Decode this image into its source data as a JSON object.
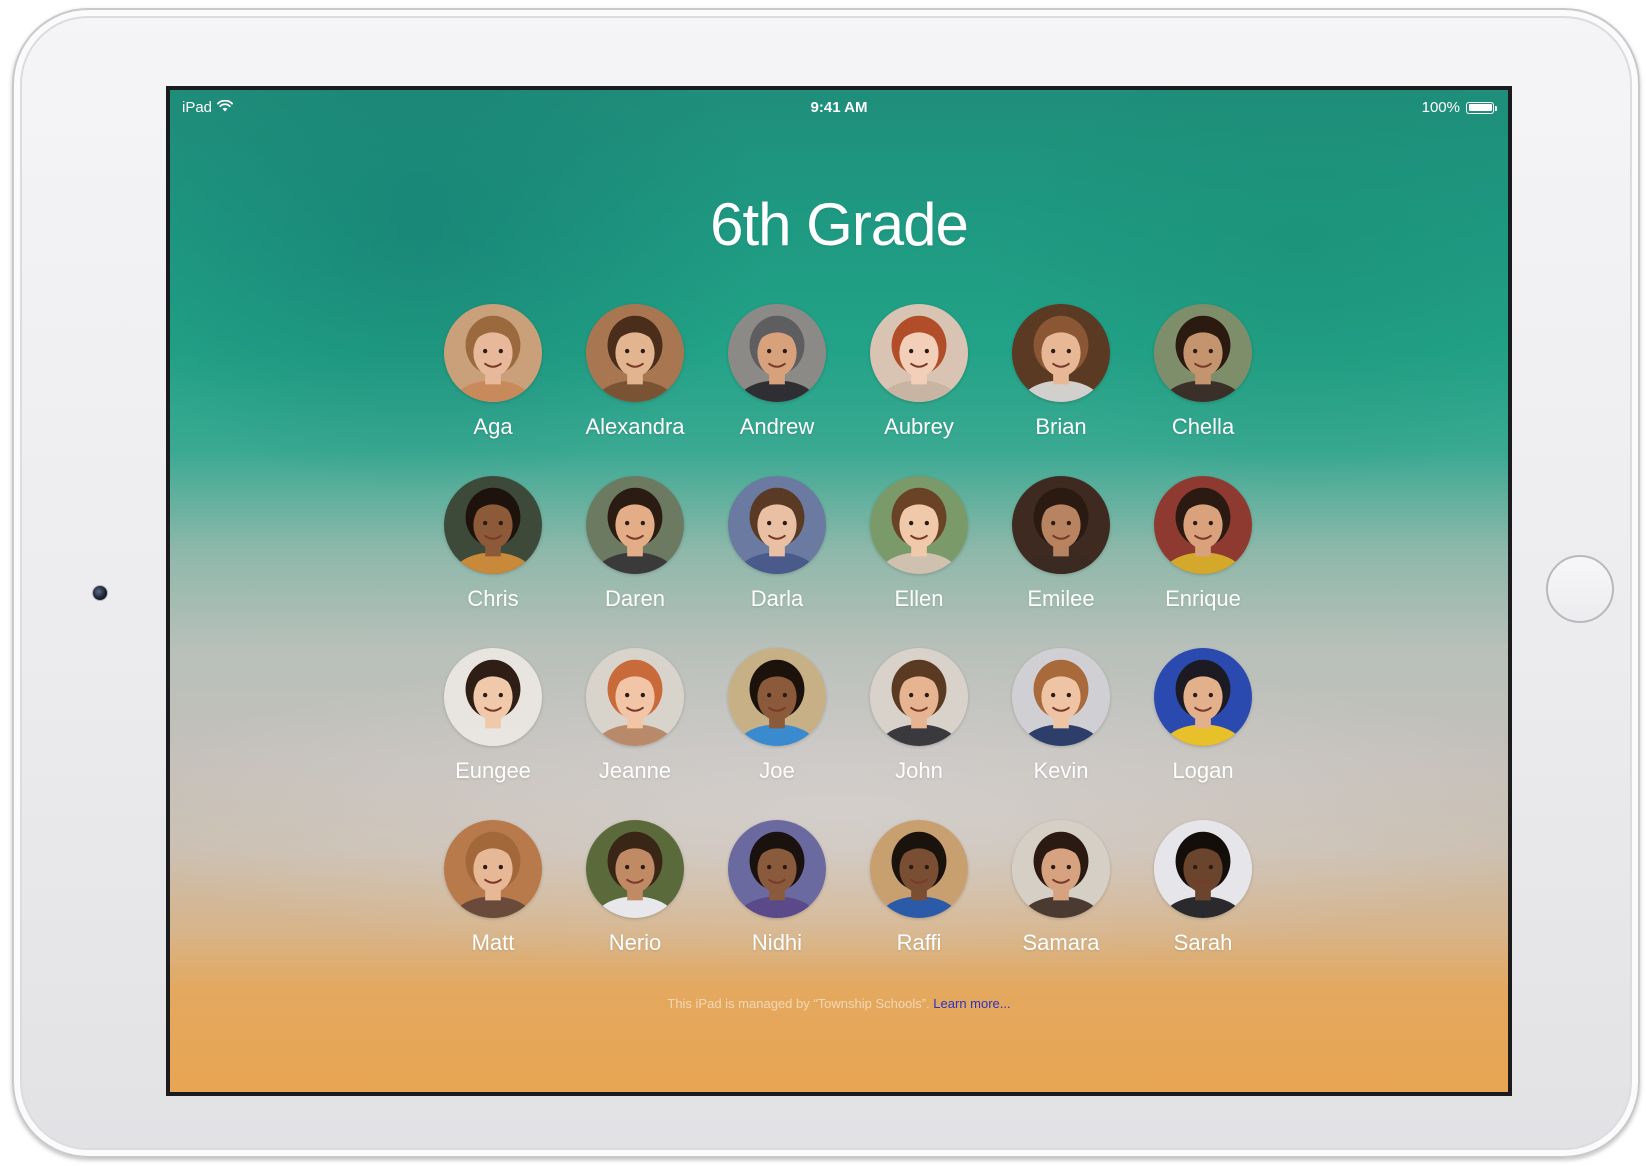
{
  "status_bar": {
    "device_label": "iPad",
    "time": "9:41 AM",
    "battery_percent": "100%",
    "battery_level": 1.0
  },
  "page": {
    "title": "6th Grade"
  },
  "students": [
    {
      "name": "Aga",
      "skin": "#e7b99a",
      "hair": "#9a6a3e",
      "bg": "#c9a07a",
      "shirt": "#c88a5a"
    },
    {
      "name": "Alexandra",
      "skin": "#e2b48f",
      "hair": "#4a2d1a",
      "bg": "#a87752",
      "shirt": "#7a5335"
    },
    {
      "name": "Andrew",
      "skin": "#d7a27b",
      "hair": "#5e5e60",
      "bg": "#8c8a86",
      "shirt": "#2f2f33"
    },
    {
      "name": "Aubrey",
      "skin": "#f3cfb9",
      "hair": "#b24d2a",
      "bg": "#d9c3b2",
      "shirt": "#c8b4a3"
    },
    {
      "name": "Brian",
      "skin": "#e8b896",
      "hair": "#8a5633",
      "bg": "#5a3a22",
      "shirt": "#d2d0cc"
    },
    {
      "name": "Chella",
      "skin": "#c4946e",
      "hair": "#2a1a10",
      "bg": "#7e8e6a",
      "shirt": "#3b2f2a"
    },
    {
      "name": "Chris",
      "skin": "#8c5a38",
      "hair": "#1e130c",
      "bg": "#3d4a3a",
      "shirt": "#c88a3a"
    },
    {
      "name": "Daren",
      "skin": "#e3ad88",
      "hair": "#2a1c12",
      "bg": "#6d7a62",
      "shirt": "#3a3a3a"
    },
    {
      "name": "Darla",
      "skin": "#e9c0a4",
      "hair": "#5a3a25",
      "bg": "#6a7aa0",
      "shirt": "#4a5a8a"
    },
    {
      "name": "Ellen",
      "skin": "#f0c8aa",
      "hair": "#6a4326",
      "bg": "#7a9a6a",
      "shirt": "#d0c0b0"
    },
    {
      "name": "Emilee",
      "skin": "#b88360",
      "hair": "#2a1a12",
      "bg": "#3e2a20",
      "shirt": "#3a2a22"
    },
    {
      "name": "Enrique",
      "skin": "#d9a27c",
      "hair": "#2a1a12",
      "bg": "#8e3a30",
      "shirt": "#d4a82a"
    },
    {
      "name": "Eungee",
      "skin": "#f0c8aa",
      "hair": "#2e1e16",
      "bg": "#e8e4e0",
      "shirt": "#e9e6e2"
    },
    {
      "name": "Jeanne",
      "skin": "#f2c5a6",
      "hair": "#c86a3a",
      "bg": "#d8d4cc",
      "shirt": "#b88a6a"
    },
    {
      "name": "Joe",
      "skin": "#8a5a3a",
      "hair": "#1c120c",
      "bg": "#c8b086",
      "shirt": "#3a8ad0"
    },
    {
      "name": "John",
      "skin": "#e6b490",
      "hair": "#5a3a22",
      "bg": "#d8d2ca",
      "shirt": "#3a3a3e"
    },
    {
      "name": "Kevin",
      "skin": "#efc4a4",
      "hair": "#a86a3a",
      "bg": "#d0cfd4",
      "shirt": "#2e3e6a"
    },
    {
      "name": "Logan",
      "skin": "#e3b08c",
      "hair": "#1c1a22",
      "bg": "#2a4ab0",
      "shirt": "#e8c02a"
    },
    {
      "name": "Matt",
      "skin": "#e6b896",
      "hair": "#a2683a",
      "bg": "#b87a4a",
      "shirt": "#6a4a3a"
    },
    {
      "name": "Nerio",
      "skin": "#c08a64",
      "hair": "#3a2616",
      "bg": "#5a6a3a",
      "shirt": "#e8e8ec"
    },
    {
      "name": "Nidhi",
      "skin": "#8a5a3c",
      "hair": "#1a120e",
      "bg": "#6a6aa0",
      "shirt": "#5a4a8a"
    },
    {
      "name": "Raffi",
      "skin": "#7a4e32",
      "hair": "#1a120c",
      "bg": "#c8a070",
      "shirt": "#2a5aa8"
    },
    {
      "name": "Samara",
      "skin": "#d6a280",
      "hair": "#2a1a12",
      "bg": "#d6cfc6",
      "shirt": "#4a3a32"
    },
    {
      "name": "Sarah",
      "skin": "#6a442c",
      "hair": "#140e0a",
      "bg": "#e6e6ea",
      "shirt": "#2a2a2e"
    }
  ],
  "footer": {
    "managed_text": "This iPad is managed by “Township Schools”.",
    "learn_more": "Learn more..."
  }
}
